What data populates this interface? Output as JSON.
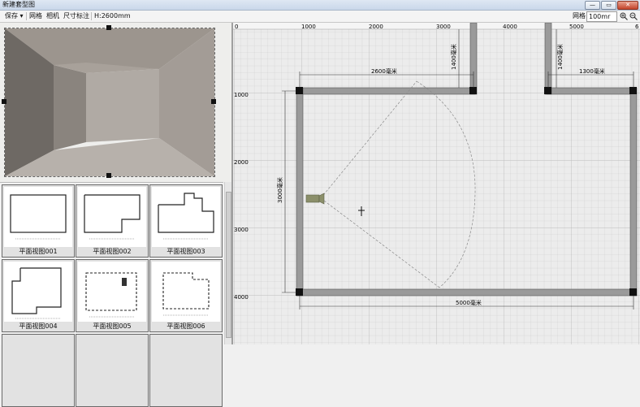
{
  "window": {
    "title": "新建套型图",
    "minimize": "—",
    "maximize": "▭",
    "close": "✕"
  },
  "toolbar": {
    "save": "保存",
    "save_arrow": "▾",
    "grid": "网格",
    "camera": "相机",
    "dimension": "尺寸标注",
    "height": "H:2600mm",
    "grid_right": "网格",
    "grid_size": "100mr",
    "zoom_in_icon": "zoom-in-icon",
    "zoom_out_icon": "zoom-out-icon"
  },
  "thumbnails": [
    {
      "label": "平面视图001"
    },
    {
      "label": "平面视图002"
    },
    {
      "label": "平面视图003"
    },
    {
      "label": "平面视图004"
    },
    {
      "label": "平面视图005"
    },
    {
      "label": "平面视图006"
    }
  ],
  "ruler": {
    "x_ticks": [
      "0",
      "1000",
      "2000",
      "3000",
      "4000",
      "5000",
      "6"
    ],
    "y_ticks": [
      "1000",
      "2000",
      "3000",
      "4000"
    ]
  },
  "dimensions": {
    "top_left": "2600毫米",
    "top_right": "1300毫米",
    "left": "3000毫米",
    "bottom": "5000毫米",
    "opening_left": "1400毫米",
    "opening_right": "1400毫米"
  }
}
